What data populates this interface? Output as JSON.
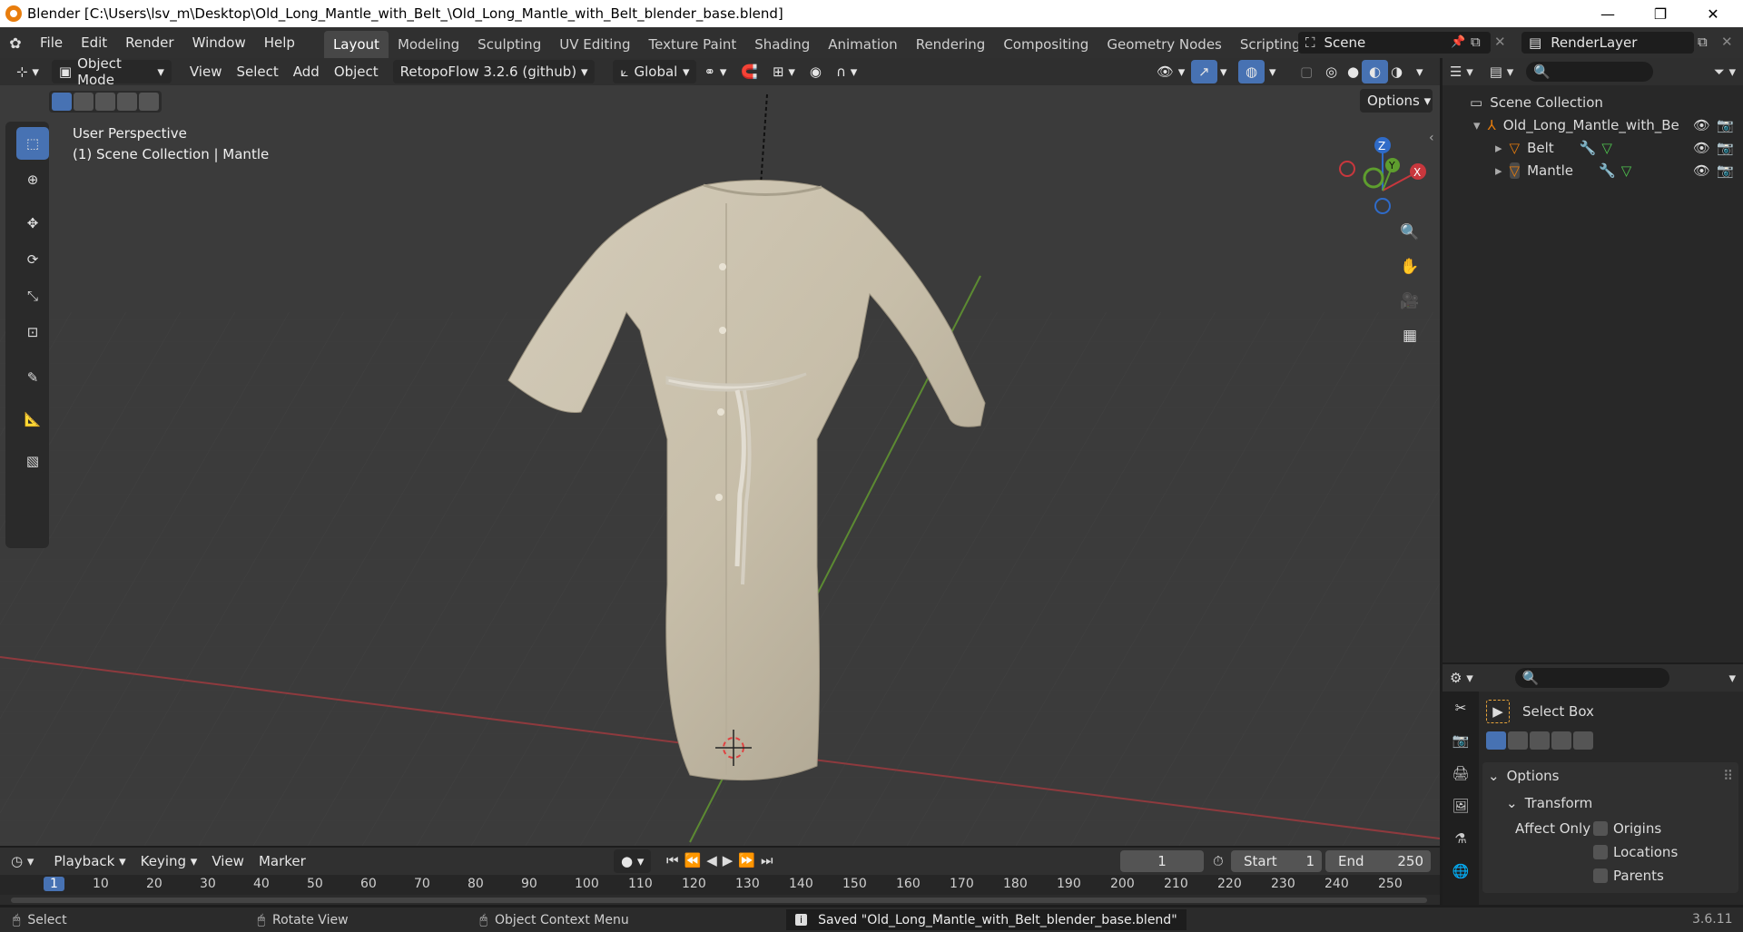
{
  "titlebar": {
    "title": "Blender [C:\\Users\\lsv_m\\Desktop\\Old_Long_Mantle_with_Belt_\\Old_Long_Mantle_with_Belt_blender_base.blend]",
    "minimize": "—",
    "restore": "❐",
    "close": "✕"
  },
  "menu": {
    "file": "File",
    "edit": "Edit",
    "render": "Render",
    "window": "Window",
    "help": "Help"
  },
  "workspaces": [
    "Layout",
    "Modeling",
    "Sculpting",
    "UV Editing",
    "Texture Paint",
    "Shading",
    "Animation",
    "Rendering",
    "Compositing",
    "Geometry Nodes",
    "Scripting"
  ],
  "scene": {
    "name": "Scene",
    "render_layer": "RenderLayer"
  },
  "viewport": {
    "mode": "Object Mode",
    "view": "View",
    "select": "Select",
    "add": "Add",
    "object": "Object",
    "addon": "RetopoFlow 3.2.6 (github)",
    "orientation": "Global",
    "options": "Options",
    "overlay_line1": "User Perspective",
    "overlay_line2": "(1) Scene Collection | Mantle",
    "gizmo": {
      "z": "Z",
      "y": "Y",
      "x": "X"
    },
    "colors": {
      "x_axis": "#c8373d",
      "y_axis": "#5e9e2e",
      "z_axis": "#2f6bc8",
      "active_tool": "#4772b3"
    }
  },
  "outliner": {
    "root": "Scene Collection",
    "items": [
      {
        "name": "Old_Long_Mantle_with_Be",
        "indent": 1
      },
      {
        "name": "Belt",
        "indent": 2
      },
      {
        "name": "Mantle",
        "indent": 2
      }
    ]
  },
  "properties": {
    "tool_name": "Select Box",
    "options": "Options",
    "transform": "Transform",
    "affect_only": "Affect Only",
    "origins": "Origins",
    "locations": "Locations",
    "parents": "Parents"
  },
  "timeline": {
    "playback": "Playback",
    "keying": "Keying",
    "view": "View",
    "marker": "Marker",
    "current_frame": "1",
    "start_label": "Start",
    "start": "1",
    "end_label": "End",
    "end": "250",
    "ruler": [
      "1",
      "10",
      "20",
      "30",
      "40",
      "50",
      "60",
      "70",
      "80",
      "90",
      "100",
      "110",
      "120",
      "130",
      "140",
      "150",
      "160",
      "170",
      "180",
      "190",
      "200",
      "210",
      "220",
      "230",
      "240",
      "250"
    ]
  },
  "status": {
    "select": "Select",
    "rotate_view": "Rotate View",
    "context_menu": "Object Context Menu",
    "message": "Saved \"Old_Long_Mantle_with_Belt_blender_base.blend\"",
    "version": "3.6.11"
  }
}
